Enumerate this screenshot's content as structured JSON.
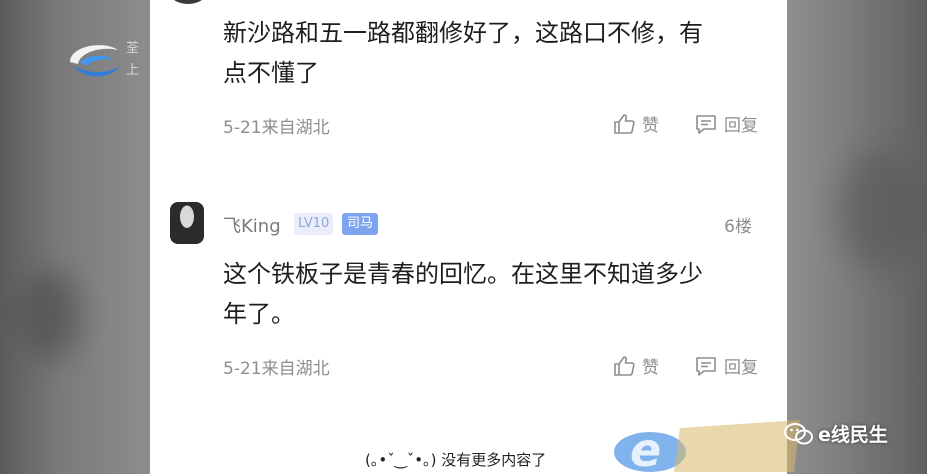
{
  "station": {
    "text": "荃上"
  },
  "comments": [
    {
      "text_line1": "新沙路和五一路都翻修好了，这路口不修，有",
      "text_line2": "点不懂了",
      "meta": "5-21来自湖北",
      "like_label": "赞",
      "reply_label": "回复"
    },
    {
      "user": "飞King",
      "level": "LV10",
      "role": "司马",
      "floor": "6楼",
      "text_line1": "这个铁板子是青春的回忆。在这里不知道多少",
      "text_line2": "年了。",
      "meta": "5-21来自湖北",
      "like_label": "赞",
      "reply_label": "回复"
    }
  ],
  "footer": {
    "no_more": "(｡•ˇ‿ˇ•｡) 没有更多内容了"
  },
  "watermark": {
    "account": "e线民生"
  },
  "colors": {
    "badge_role": "#7ea4ee",
    "badge_level_text": "#8fa7d6",
    "meta_gray": "#8e8e8e"
  }
}
